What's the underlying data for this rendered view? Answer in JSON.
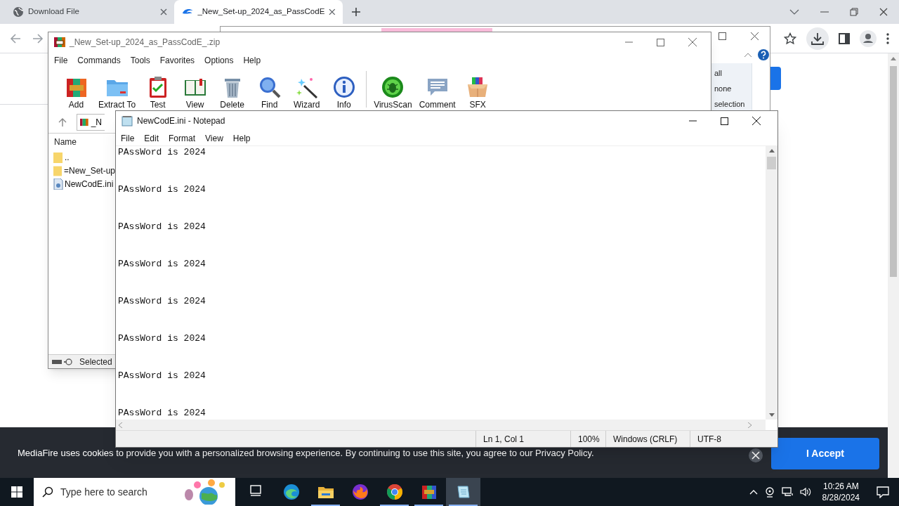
{
  "browser": {
    "tabs": [
      {
        "title": "Download File",
        "selected": false
      },
      {
        "title": "_New_Set-up_2024_as_PassCodE",
        "selected": true
      }
    ]
  },
  "background_window": {
    "items": [
      "all",
      "none",
      "selection"
    ]
  },
  "winrar": {
    "title": "_New_Set-up_2024_as_PassCodE_.zip",
    "menu": [
      "File",
      "Commands",
      "Tools",
      "Favorites",
      "Options",
      "Help"
    ],
    "toolbar": [
      "Add",
      "Extract To",
      "Test",
      "View",
      "Delete",
      "Find",
      "Wizard",
      "Info",
      "VirusScan",
      "Comment",
      "SFX"
    ],
    "path": "_N",
    "columns": [
      "Name"
    ],
    "files": [
      {
        "name": "..",
        "kind": "folder"
      },
      {
        "name": "=New_Set-up",
        "kind": "folder"
      },
      {
        "name": "NewCodE.ini",
        "kind": "file"
      }
    ],
    "status": "Selected"
  },
  "notepad": {
    "title": "NewCodE.ini - Notepad",
    "menu": [
      "File",
      "Edit",
      "Format",
      "View",
      "Help"
    ],
    "lines": [
      "PAssWord is 2024",
      "PAssWord is 2024",
      "PAssWord is 2024",
      "PAssWord is 2024",
      "PAssWord is 2024",
      "PAssWord is 2024",
      "PAssWord is 2024",
      "PAssWord is 2024"
    ],
    "status": [
      "Ln 1, Col 1",
      "100%",
      "Windows (CRLF)",
      "UTF-8"
    ]
  },
  "cookie_banner": {
    "text": "MediaFire uses cookies to provide you with a personalized browsing experience. By continuing to use this site, you agree to our Privacy Policy.",
    "button": "I Accept"
  },
  "taskbar": {
    "search_placeholder": "Type here to search",
    "apps": [
      {
        "running": false,
        "selected": false
      },
      {
        "running": false,
        "selected": false
      },
      {
        "running": true,
        "selected": false
      },
      {
        "running": false,
        "selected": false
      },
      {
        "running": true,
        "selected": false
      },
      {
        "running": true,
        "selected": false
      },
      {
        "running": true,
        "selected": true
      }
    ],
    "time": "10:26 AM",
    "date": "8/28/2024"
  }
}
